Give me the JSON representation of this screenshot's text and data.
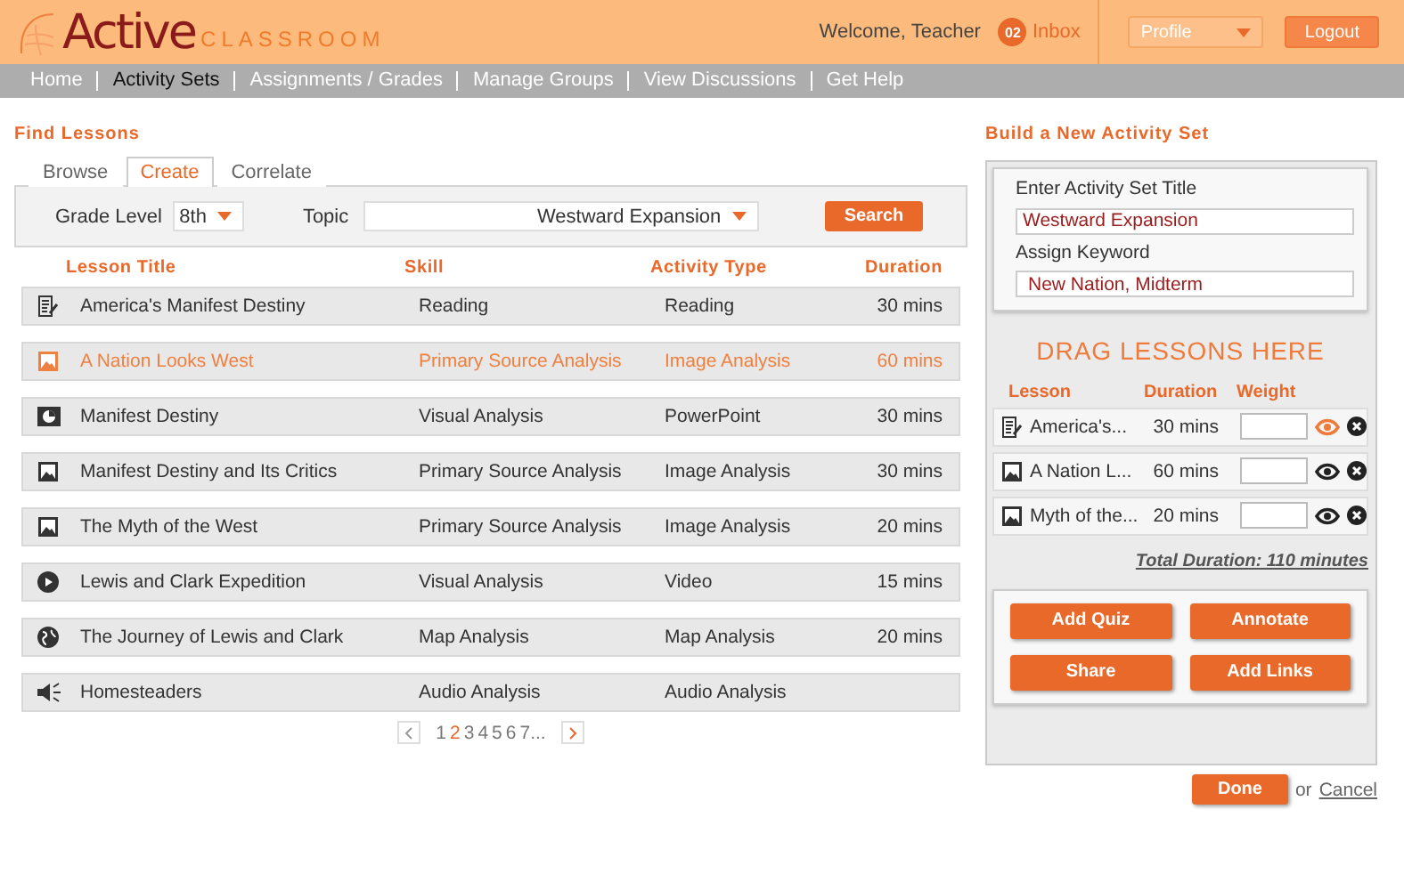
{
  "header": {
    "logo_main": "Active",
    "logo_sub": "CLASSROOM",
    "welcome": "Welcome, Teacher",
    "inbox_count": "02",
    "inbox": "Inbox",
    "profile": "Profile",
    "logout": "Logout"
  },
  "nav": [
    {
      "label": "Home",
      "selected": false
    },
    {
      "label": "Activity Sets",
      "selected": true
    },
    {
      "label": "Assignments / Grades",
      "selected": false
    },
    {
      "label": "Manage Groups",
      "selected": false
    },
    {
      "label": "View Discussions",
      "selected": false
    },
    {
      "label": "Get Help",
      "selected": false
    }
  ],
  "find": {
    "title": "Find Lessons",
    "tabs": [
      {
        "label": "Browse",
        "selected": false
      },
      {
        "label": "Create",
        "selected": true
      },
      {
        "label": "Correlate",
        "selected": false
      }
    ],
    "grade_label": "Grade Level",
    "grade": "8th",
    "topic_label": "Topic",
    "topic": "Westward Expansion",
    "search": "Search",
    "columns": [
      "Lesson Title",
      "Skill",
      "Activity Type",
      "Duration"
    ],
    "rows": [
      {
        "kind": "reading",
        "title": "America's Manifest Destiny",
        "skill": "Reading",
        "type": "Reading",
        "duration": "30 mins",
        "selected": false
      },
      {
        "kind": "image",
        "title": "A Nation Looks West",
        "skill": "Primary Source Analysis",
        "type": "Image Analysis",
        "duration": "60 mins",
        "selected": true
      },
      {
        "kind": "slides",
        "title": "Manifest Destiny",
        "skill": "Visual Analysis",
        "type": "PowerPoint",
        "duration": "30 mins",
        "selected": false
      },
      {
        "kind": "image",
        "title": "Manifest Destiny and Its Critics",
        "skill": "Primary Source Analysis",
        "type": "Image Analysis",
        "duration": "30 mins",
        "selected": false
      },
      {
        "kind": "image",
        "title": "The Myth of the West",
        "skill": "Primary Source Analysis",
        "type": "Image Analysis",
        "duration": "20 mins",
        "selected": false
      },
      {
        "kind": "video",
        "title": "Lewis and Clark Expedition",
        "skill": "Visual Analysis",
        "type": "Video",
        "duration": "15 mins",
        "selected": false
      },
      {
        "kind": "map",
        "title": "The Journey of Lewis and Clark",
        "skill": "Map Analysis",
        "type": "Map Analysis",
        "duration": "20 mins",
        "selected": false
      },
      {
        "kind": "audio",
        "title": "Homesteaders",
        "skill": "Audio Analysis",
        "type": "Audio Analysis",
        "selected": false
      }
    ],
    "pages": [
      {
        "label": "1",
        "selected": false
      },
      {
        "label": "2",
        "selected": true
      },
      {
        "label": "3",
        "selected": false
      },
      {
        "label": "4",
        "selected": false
      },
      {
        "label": "5",
        "selected": false
      },
      {
        "label": "6",
        "selected": false
      },
      {
        "label": "7...",
        "selected": false
      }
    ]
  },
  "build": {
    "title": "Build a New Activity Set",
    "title_label": "Enter Activity Set Title",
    "title_value": "Westward Expansion",
    "keyword_label": "Assign Keyword",
    "keyword_value": "New Nation, Midterm",
    "drop": "DRAG LESSONS HERE",
    "columns": [
      "Lesson",
      "Duration",
      "Weight"
    ],
    "items": [
      {
        "kind": "reading",
        "lesson": "America's...",
        "duration": "30 mins",
        "previewing": true
      },
      {
        "kind": "image",
        "lesson": "A Nation L...",
        "duration": "60 mins",
        "previewing": false
      },
      {
        "kind": "image",
        "lesson": "Myth of the...",
        "duration": "20 mins",
        "previewing": false
      }
    ],
    "total": "Total Duration: 110 minutes",
    "actions": [
      "Add Quiz",
      "Annotate",
      "Share",
      "Add Links"
    ],
    "done": "Done",
    "or": "or",
    "cancel": "Cancel"
  }
}
